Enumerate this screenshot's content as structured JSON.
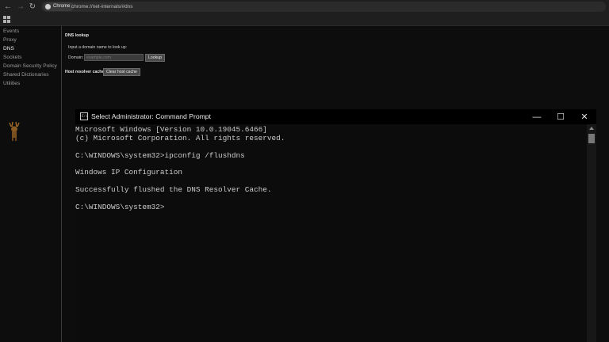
{
  "browser": {
    "chip_label": "Chrome",
    "url": "chrome://net-internals/#dns"
  },
  "sidebar": {
    "items": [
      {
        "label": "Events",
        "active": false
      },
      {
        "label": "Proxy",
        "active": false
      },
      {
        "label": "DNS",
        "active": true
      },
      {
        "label": "Sockets",
        "active": false
      },
      {
        "label": "Domain Security Policy",
        "active": false
      },
      {
        "label": "Shared Dictionaries",
        "active": false
      },
      {
        "label": "Utilities",
        "active": false
      }
    ]
  },
  "dns_page": {
    "heading": "DNS lookup",
    "input_instruction": "Input a domain name to look up:",
    "domain_label": "Domain:",
    "domain_placeholder": "example.com",
    "lookup_button": "Lookup",
    "host_cache_label": "Host resolver cache:",
    "clear_cache_button": "Clear host cache"
  },
  "cmd": {
    "title": "Select Administrator: Command Prompt",
    "icon_text": "C:\\",
    "lines": [
      "Microsoft Windows [Version 10.0.19045.6466]",
      "(c) Microsoft Corporation. All rights reserved.",
      "",
      "C:\\WINDOWS\\system32>ipconfig /flushdns",
      "",
      "Windows IP Configuration",
      "",
      "Successfully flushed the DNS Resolver Cache.",
      "",
      "C:\\WINDOWS\\system32>"
    ],
    "controls": {
      "minimize": "—",
      "maximize": "☐",
      "close": "✕"
    }
  },
  "icons": {
    "back": "back-arrow-icon",
    "forward": "forward-arrow-icon",
    "reload": "reload-icon",
    "apps": "apps-grid-icon",
    "deer": "deer-icon"
  },
  "colors": {
    "page_bg": "#0d0d0d",
    "cmd_bg": "#0c0c0c",
    "cmd_text": "#cccccc",
    "title_bar": "#000000"
  }
}
